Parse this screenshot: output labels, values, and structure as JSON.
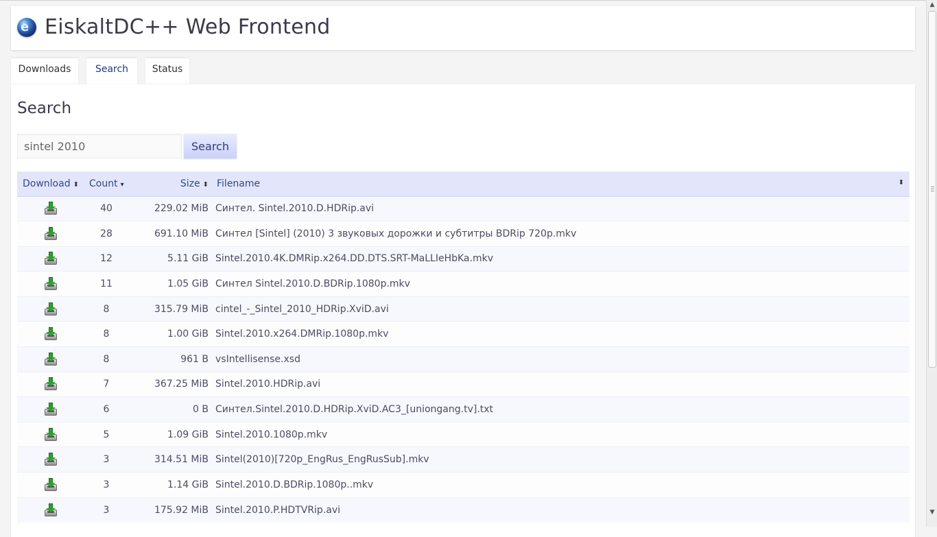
{
  "app": {
    "title": "EiskaltDC++ Web Frontend",
    "logo_icon": "globe-logo-icon"
  },
  "tabs": [
    {
      "label": "Downloads",
      "active": false
    },
    {
      "label": "Search",
      "active": true
    },
    {
      "label": "Status",
      "active": false
    }
  ],
  "search": {
    "heading": "Search",
    "query": "sintel 2010",
    "button_label": "Search"
  },
  "results": {
    "columns": [
      {
        "label": "Download",
        "sort_icon": "sort-both-icon"
      },
      {
        "label": "Count",
        "sort_icon": "sort-desc-icon"
      },
      {
        "label": "Size",
        "sort_icon": "sort-both-icon"
      },
      {
        "label": "Filename",
        "sort_icon": "sort-both-icon"
      }
    ],
    "rows": [
      {
        "count": "40",
        "size": "229.02 MiB",
        "filename": "Синтел. Sintel.2010.D.HDRip.avi"
      },
      {
        "count": "28",
        "size": "691.10 MiB",
        "filename": "Синтел [Sintel] (2010) 3 звуковых дорожки и субтитры BDRip 720p.mkv"
      },
      {
        "count": "12",
        "size": "5.11 GiB",
        "filename": "Sintel.2010.4K.DMRip.x264.DD.DTS.SRT-MaLLIeHbKa.mkv"
      },
      {
        "count": "11",
        "size": "1.05 GiB",
        "filename": "Синтел Sintel.2010.D.BDRip.1080p.mkv"
      },
      {
        "count": "8",
        "size": "315.79 MiB",
        "filename": "cintel_-_Sintel_2010_HDRip.XviD.avi"
      },
      {
        "count": "8",
        "size": "1.00 GiB",
        "filename": "Sintel.2010.x264.DMRip.1080p.mkv"
      },
      {
        "count": "8",
        "size": "961 B",
        "filename": "vsIntellisense.xsd"
      },
      {
        "count": "7",
        "size": "367.25 MiB",
        "filename": "Sintel.2010.HDRip.avi"
      },
      {
        "count": "6",
        "size": "0 B",
        "filename": "Синтел.Sintel.2010.D.HDRip.XviD.AC3_[uniongang.tv].txt"
      },
      {
        "count": "5",
        "size": "1.09 GiB",
        "filename": "Sintel.2010.1080p.mkv"
      },
      {
        "count": "3",
        "size": "314.51 MiB",
        "filename": "Sintel(2010)[720p_EngRus_EngRusSub].mkv"
      },
      {
        "count": "3",
        "size": "1.14 GiB",
        "filename": "Sintel.2010.D.BDRip.1080p..mkv"
      },
      {
        "count": "3",
        "size": "175.92 MiB",
        "filename": "Sintel.2010.P.HDTVRip.avi"
      }
    ]
  },
  "colors": {
    "header_row": "#e3e6fb",
    "link": "#2e4a86",
    "button_gradient_top": "#e9ecff",
    "button_gradient_bottom": "#c9d1f7",
    "download_icon_green": "#2fa02f"
  }
}
